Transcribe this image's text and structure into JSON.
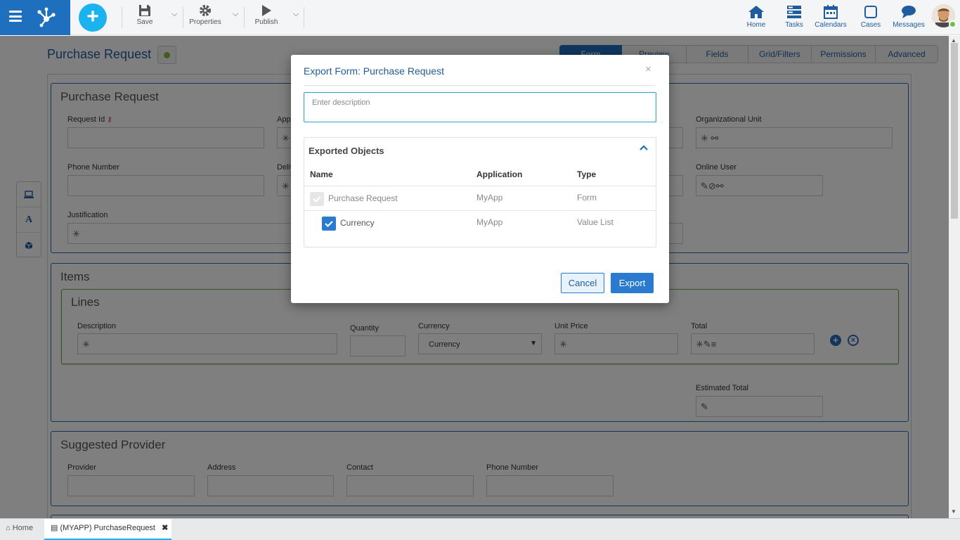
{
  "toolbar": {
    "save": "Save",
    "properties": "Properties",
    "publish": "Publish"
  },
  "nav": {
    "home": "Home",
    "tasks": "Tasks",
    "calendars": "Calendars",
    "cases": "Cases",
    "messages": "Messages"
  },
  "page": {
    "title": "Purchase Request",
    "tabs": [
      "Form",
      "Preview",
      "Fields",
      "Grid/Filters",
      "Permissions",
      "Advanced"
    ]
  },
  "form": {
    "group1": {
      "title": "Purchase Request",
      "request_id": "Request Id",
      "applicant_partial": "Appl",
      "delivery_partial": "Deliv",
      "organizational_unit": "Organizational Unit",
      "phone_number": "Phone Number",
      "online_user": "Online User",
      "justification": "Justification"
    },
    "group2": {
      "title": "Items",
      "lines_title": "Lines",
      "description": "Description",
      "quantity": "Quantity",
      "currency": "Currency",
      "currency_value": "Currency",
      "unit_price": "Unit Price",
      "total": "Total",
      "estimated_total": "Estimated Total"
    },
    "group3": {
      "title": "Suggested Provider",
      "provider": "Provider",
      "address": "Address",
      "contact": "Contact",
      "phone_number": "Phone Number"
    }
  },
  "bottom_tabs": {
    "home": "Home",
    "doc": "(MYAPP) PurchaseRequest"
  },
  "modal": {
    "title": "Export Form: Purchase Request",
    "close": "×",
    "description_placeholder": "Enter description",
    "exported_objects": "Exported Objects",
    "columns": {
      "name": "Name",
      "application": "Application",
      "type": "Type"
    },
    "rows": [
      {
        "name": "Purchase Request",
        "application": "MyApp",
        "type": "Form",
        "checked": true,
        "disabled": true
      },
      {
        "name": "Currency",
        "application": "MyApp",
        "type": "Value List",
        "checked": true,
        "disabled": false
      }
    ],
    "cancel": "Cancel",
    "export": "Export"
  },
  "colors": {
    "brand": "#1f6fbf",
    "accent": "#1ab2ef",
    "group_border": "#2a6cb8",
    "lines_border": "#6aa84f"
  }
}
